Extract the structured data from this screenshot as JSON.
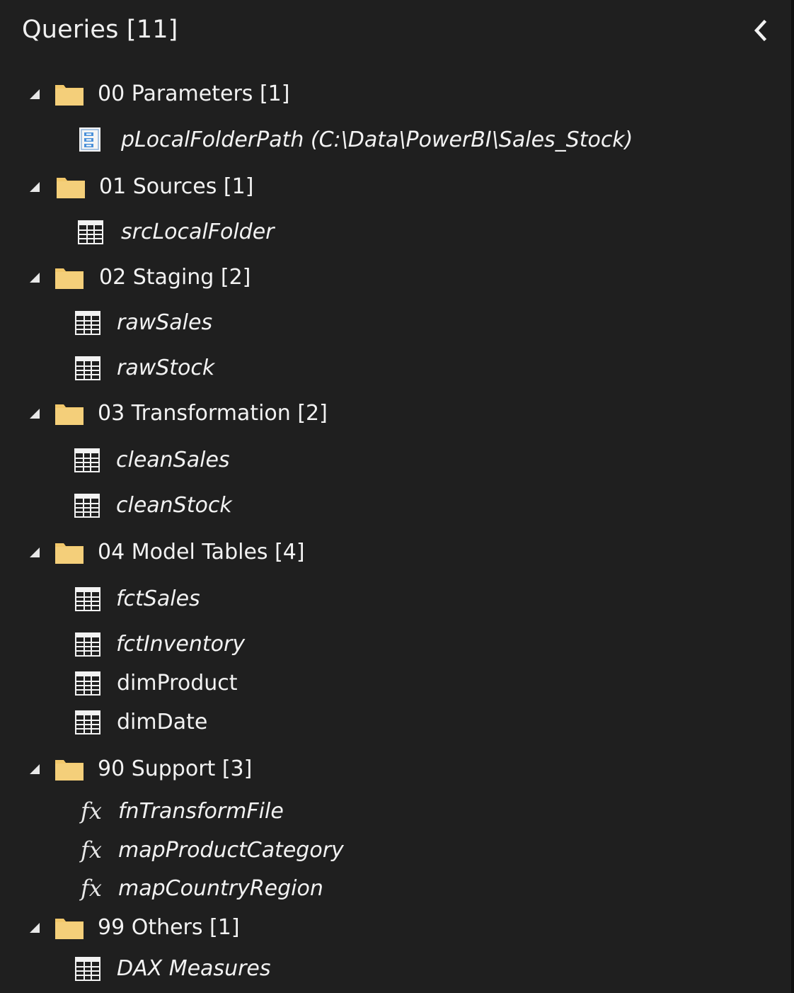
{
  "panel": {
    "title": "Queries [11]"
  },
  "groups": [
    {
      "label": "00 Parameters [1]",
      "items": [
        {
          "label": "pLocalFolderPath (C:\\Data\\PowerBI\\Sales_Stock)",
          "icon": "parameter-icon",
          "italic": true
        }
      ]
    },
    {
      "label": "01 Sources [1]",
      "items": [
        {
          "label": "srcLocalFolder",
          "icon": "table-icon",
          "italic": true
        }
      ]
    },
    {
      "label": "02 Staging [2]",
      "items": [
        {
          "label": "rawSales",
          "icon": "table-icon",
          "italic": true
        },
        {
          "label": "rawStock",
          "icon": "table-icon",
          "italic": true
        }
      ]
    },
    {
      "label": "03 Transformation [2]",
      "items": [
        {
          "label": "cleanSales",
          "icon": "table-icon",
          "italic": true
        },
        {
          "label": "cleanStock",
          "icon": "table-icon",
          "italic": true
        }
      ]
    },
    {
      "label": "04 Model Tables [4]",
      "items": [
        {
          "label": "fctSales",
          "icon": "table-icon",
          "italic": true
        },
        {
          "label": "fctInventory",
          "icon": "table-icon",
          "italic": true
        },
        {
          "label": "dimProduct",
          "icon": "table-icon",
          "italic": false
        },
        {
          "label": "dimDate",
          "icon": "table-icon",
          "italic": false
        }
      ]
    },
    {
      "label": "90 Support [3]",
      "items": [
        {
          "label": "fnTransformFile",
          "icon": "function-icon",
          "italic": true
        },
        {
          "label": "mapProductCategory",
          "icon": "function-icon",
          "italic": true
        },
        {
          "label": "mapCountryRegion",
          "icon": "function-icon",
          "italic": true
        }
      ]
    },
    {
      "label": "99 Others [1]",
      "items": [
        {
          "label": "DAX Measures",
          "icon": "table-icon",
          "italic": true
        }
      ]
    }
  ],
  "colors": {
    "background": "#1f1f1f",
    "folder": "#f2c86b",
    "text": "#f2f2f2"
  },
  "fx_glyph": "fx"
}
